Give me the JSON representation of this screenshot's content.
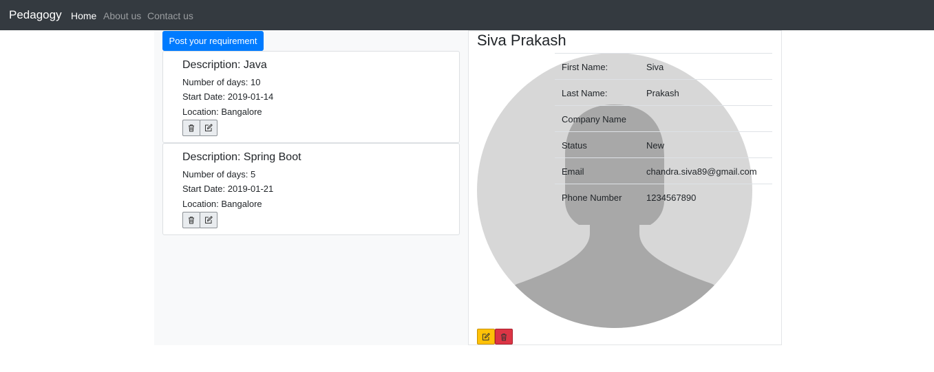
{
  "navbar": {
    "brand": "Pedagogy",
    "links": [
      {
        "label": "Home",
        "active": true
      },
      {
        "label": "About us",
        "active": false
      },
      {
        "label": "Contact us",
        "active": false
      }
    ]
  },
  "left": {
    "post_button": "Post your requirement",
    "requirements": [
      {
        "description": "Description: Java",
        "days": "Number of days: 10",
        "start": "Start Date: 2019-01-14",
        "location": "Location: Bangalore"
      },
      {
        "description": "Description: Spring Boot",
        "days": "Number of days: 5",
        "start": "Start Date: 2019-01-21",
        "location": "Location: Bangalore"
      }
    ],
    "row_icons": [
      "trash-icon",
      "edit-icon"
    ]
  },
  "profile": {
    "name": "Siva Prakash",
    "avatar_icon": "user-silhouette-icon",
    "fields": [
      {
        "label": "First Name:",
        "value": "Siva"
      },
      {
        "label": "Last Name:",
        "value": "Prakash"
      },
      {
        "label": "Company Name",
        "value": ""
      },
      {
        "label": "Status",
        "value": "New"
      },
      {
        "label": "Email",
        "value": "chandra.siva89@gmail.com"
      },
      {
        "label": "Phone Number",
        "value": "1234567890"
      }
    ],
    "action_icons": [
      "edit-icon",
      "trash-icon"
    ]
  },
  "colors": {
    "navbar": "#343a40",
    "primary": "#007bff",
    "warning": "#ffc107",
    "danger": "#dc3545"
  }
}
